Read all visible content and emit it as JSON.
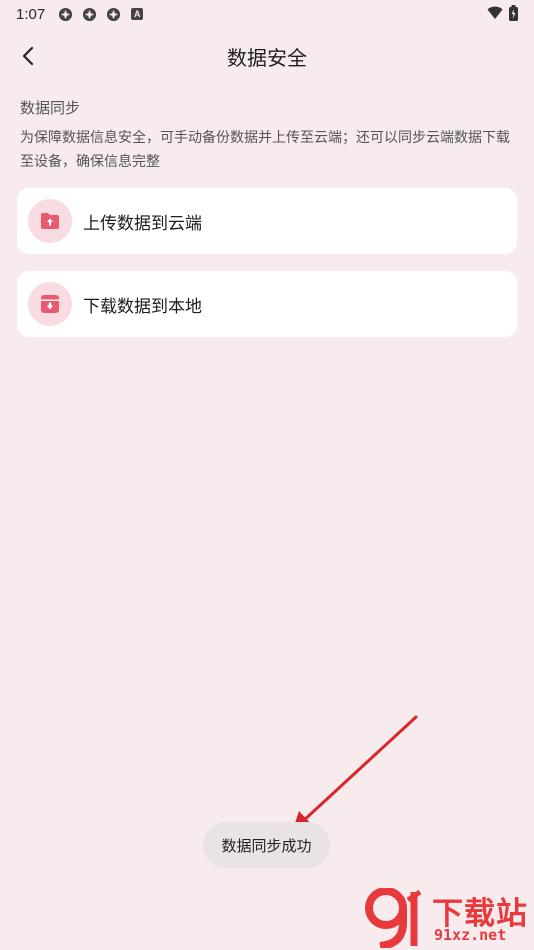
{
  "status_bar": {
    "time": "1:07",
    "notification_icons": [
      "pinwheel-icon",
      "pinwheel-icon",
      "pinwheel-icon",
      "a-badge-icon"
    ],
    "a_badge": "A",
    "right_icons": [
      "wifi-icon",
      "battery-icon"
    ]
  },
  "header": {
    "title": "数据安全",
    "back_icon": "chevron-left-icon"
  },
  "section": {
    "title": "数据同步",
    "description": "为保障数据信息安全，可手动备份数据并上传至云端；还可以同步云端数据下载至设备，确保信息完整"
  },
  "options": [
    {
      "label": "上传数据到云端",
      "icon": "upload-folder-icon"
    },
    {
      "label": "下载数据到本地",
      "icon": "download-box-icon"
    }
  ],
  "toast": {
    "message": "数据同步成功"
  },
  "watermark": {
    "brand": "下载站",
    "site": "91xz.net",
    "logo_text": "9"
  },
  "colors": {
    "background": "#f7ebee",
    "card": "#ffffff",
    "icon_circle": "#f9dce1",
    "accent": "#e85a70",
    "arrow": "#d9252b"
  }
}
